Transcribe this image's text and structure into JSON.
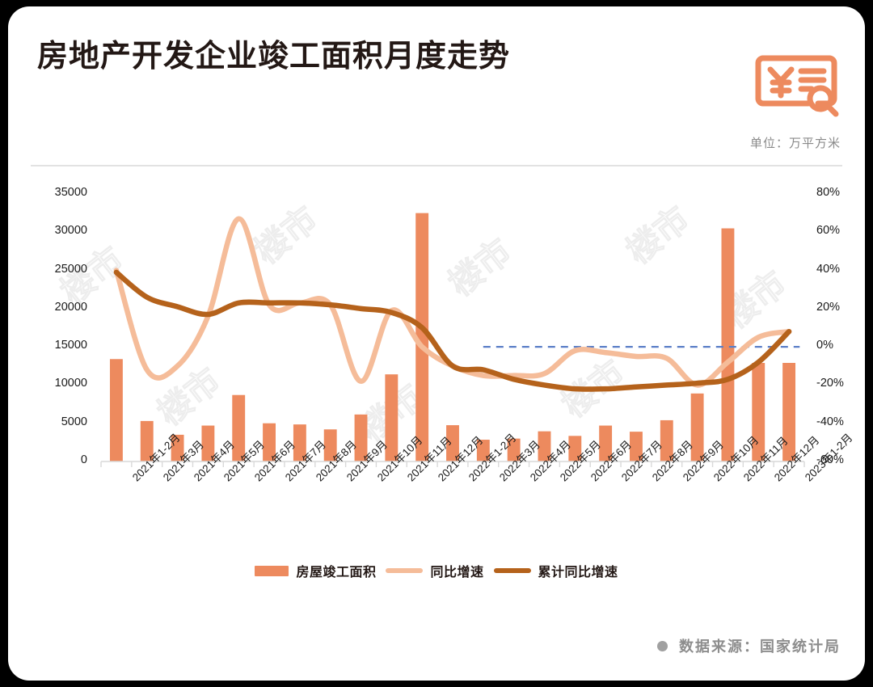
{
  "header": {
    "title": "房地产开发企业竣工面积月度走势",
    "unit": "单位：万平方米",
    "logo_name": "yen-document-search-logo"
  },
  "footer": {
    "source": "数据来源：国家统计局"
  },
  "legend": {
    "items": [
      {
        "label": "房屋竣工面积",
        "type": "bar",
        "color": "#ED8A5E"
      },
      {
        "label": "同比增速",
        "type": "line",
        "color": "#F5BC99"
      },
      {
        "label": "累计同比增速",
        "type": "line",
        "color": "#B5621B"
      }
    ]
  },
  "chart_data": {
    "type": "bar",
    "title": "房地产开发企业竣工面积月度走势",
    "subtitle": "单位：万平方米",
    "xlabel": "",
    "ylabel": "万平方米",
    "y2label": "%",
    "ylim": [
      0,
      35000
    ],
    "y2lim": [
      -60,
      80
    ],
    "yticks": [
      "0",
      "5000",
      "10000",
      "15000",
      "20000",
      "25000",
      "30000",
      "35000"
    ],
    "y2ticks": [
      "-60%",
      "-40%",
      "-20%",
      "0%",
      "20%",
      "40%",
      "60%",
      "80%"
    ],
    "grid": false,
    "legend_position": "bottom",
    "categories": [
      "2021年1-2月",
      "2021年3月",
      "2021年4月",
      "2021年5月",
      "2021年6月",
      "2021年7月",
      "2021年8月",
      "2021年9月",
      "2021年10月",
      "2021年11月",
      "2021年12月",
      "2022年1-2月",
      "2022年3月",
      "2022年4月",
      "2022年5月",
      "2022年6月",
      "2022年7月",
      "2022年8月",
      "2022年9月",
      "2022年10月",
      "2022年11月",
      "2022年12月",
      "2023年1-2月"
    ],
    "series": [
      {
        "name": "房屋竣工面积",
        "type": "bar",
        "axis": "left",
        "color": "#ED8A5E",
        "values": [
          13400,
          5300,
          3500,
          4700,
          8700,
          5000,
          4850,
          4200,
          6150,
          11400,
          32500,
          4750,
          2850,
          3000,
          3950,
          3350,
          4700,
          3900,
          5400,
          8900,
          30500,
          12900,
          12900
        ]
      },
      {
        "name": "同比增速",
        "type": "line",
        "axis": "right",
        "color": "#F5BC99",
        "values": [
          40,
          -12,
          -10,
          16,
          67,
          22,
          23,
          22,
          -18,
          19,
          0,
          -10,
          -15,
          -15,
          -14,
          -2,
          -3,
          -5,
          -6,
          -20,
          -8,
          5,
          8
        ]
      },
      {
        "name": "累计同比增速",
        "type": "line",
        "axis": "right",
        "color": "#B5621B",
        "values": [
          39,
          26,
          21,
          17,
          23,
          23,
          23,
          22,
          20,
          18,
          10,
          -10,
          -12,
          -17,
          -20,
          -22,
          -22,
          -21,
          -20,
          -19,
          -17,
          -8,
          8
        ]
      }
    ],
    "reference_line": {
      "name": "zero-reference",
      "value": 0,
      "axis": "right",
      "style": "dashed",
      "color": "#5B7FC7",
      "from_category": "2022年3月",
      "to_category": "2023年1-2月"
    }
  }
}
